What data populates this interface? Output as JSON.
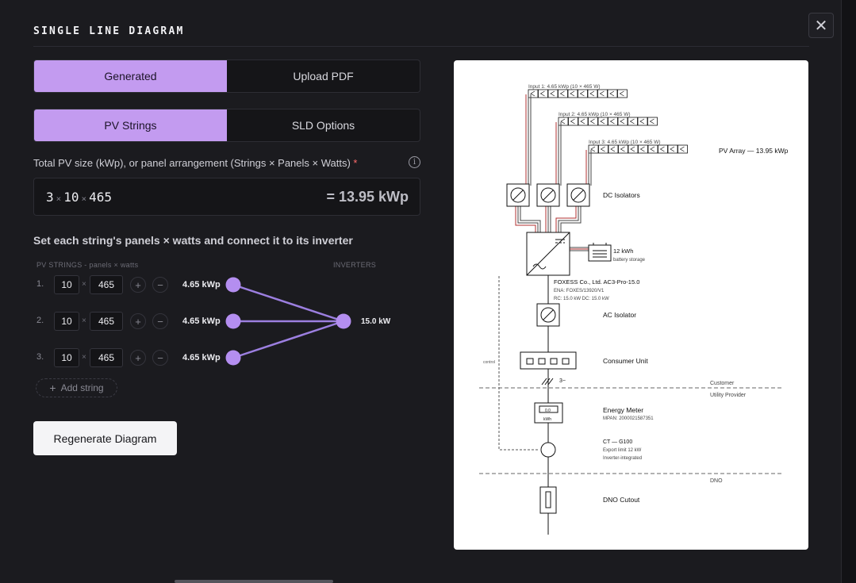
{
  "modal": {
    "title": "SINGLE LINE DIAGRAM",
    "close_glyph": "✕"
  },
  "source_tabs": {
    "generated": "Generated",
    "upload": "Upload PDF",
    "active": "Generated"
  },
  "option_tabs": {
    "pv_strings": "PV Strings",
    "sld_options": "SLD Options",
    "active": "PV Strings"
  },
  "pv_size": {
    "label": "Total PV size (kWp), or panel arrangement (Strings × Panels × Watts)",
    "required_mark": "*",
    "strings": "3",
    "panels": "10",
    "watts": "465",
    "separator": "×",
    "total": "= 13.95 kWp"
  },
  "strings_section": {
    "heading": "Set each string's panels × watts and connect it to its inverter",
    "col_strings": "PV STRINGS - panels × watts",
    "col_inverters": "INVERTERS",
    "rows": [
      {
        "num": "1.",
        "panels": "10",
        "watts": "465",
        "kwp": "4.65 kWp"
      },
      {
        "num": "2.",
        "panels": "10",
        "watts": "465",
        "kwp": "4.65 kWp"
      },
      {
        "num": "3.",
        "panels": "10",
        "watts": "465",
        "kwp": "4.65 kWp"
      }
    ],
    "times": "×",
    "plus": "+",
    "minus": "−",
    "inverter_kw": "15.0 kW",
    "add_string": "Add string"
  },
  "regenerate_label": "Regenerate Diagram",
  "colors": {
    "accent": "#c39bf0",
    "node": "#b48ef0",
    "link": "#9c7fe0"
  },
  "sld": {
    "input_labels": [
      "Input 1: 4.65 kWp (10 × 465 W)",
      "Input 2: 4.65 kWp (10 × 465 W)",
      "Input 3: 4.65 kWp (10 × 465 W)"
    ],
    "pv_array": "PV Array — 13.95 kWp",
    "dc_isolators": "DC Isolators",
    "battery_1": "12 kWh",
    "battery_2": "battery storage",
    "inverter_1": "FOXESS Co., Ltd. AC3-Pro-15.0",
    "inverter_2": "ENA: FOXES/13920/V1",
    "inverter_3": "RC: 15.0 kW DC: 15.0 kW",
    "ac_isolator": "AC Isolator",
    "consumer_unit": "Consumer Unit",
    "control": "control",
    "phase": "3~",
    "customer": "Customer",
    "utility": "Utility Provider",
    "energy_meter": "Energy Meter",
    "mpan": "MPAN: 2000021587351",
    "meter_unit": "kWh",
    "meter_reading": "0.0",
    "ct_1": "CT — G100",
    "ct_2": "Export limit 12 kW",
    "ct_3": "Inverter-integrated",
    "dno": "DNO",
    "dno_cutout": "DNO Cutout"
  }
}
